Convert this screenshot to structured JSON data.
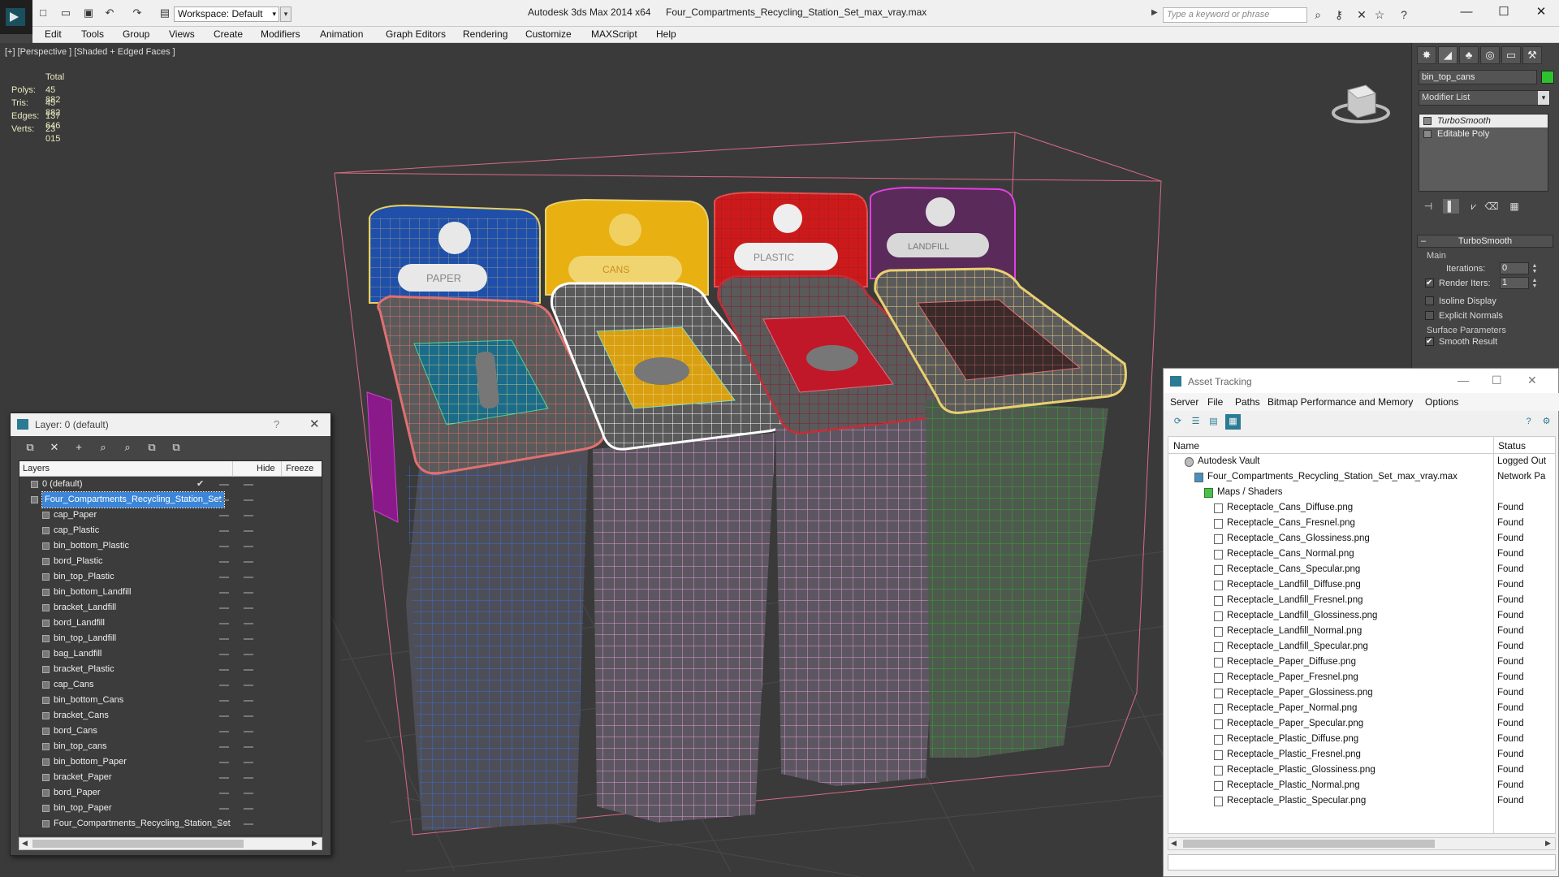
{
  "titlebar": {
    "workspace": "Workspace: Default",
    "app_title": "Autodesk 3ds Max  2014 x64",
    "file_title": "Four_Compartments_Recycling_Station_Set_max_vray.max",
    "search_placeholder": "Type a keyword or phrase",
    "minimize": "—",
    "maximize": "☐",
    "close": "✕"
  },
  "menubar": [
    "Edit",
    "Tools",
    "Group",
    "Views",
    "Create",
    "Modifiers",
    "Animation",
    "Graph Editors",
    "Rendering",
    "Customize",
    "MAXScript",
    "Help"
  ],
  "viewport": {
    "label": "[+] [Perspective ] [Shaded + Edged Faces ]",
    "stats": {
      "header": "Total",
      "rows": [
        {
          "label": "Polys:",
          "value": "45 882"
        },
        {
          "label": "Tris:",
          "value": "45 882"
        },
        {
          "label": "Edges:",
          "value": "137 646"
        },
        {
          "label": "Verts:",
          "value": "23 015"
        }
      ]
    },
    "bin_labels": [
      "PAPER",
      "CANS",
      "PLASTIC",
      "LANDFILL"
    ]
  },
  "command_panel": {
    "object_name": "bin_top_cans",
    "object_color": "#2ec12e",
    "modifier_list": "Modifier List",
    "stack": [
      "TurboSmooth",
      "Editable Poly"
    ],
    "turbosmooth": {
      "title": "TurboSmooth",
      "main": "Main",
      "iterations_label": "Iterations:",
      "iterations_value": "0",
      "render_iters_label": "Render Iters:",
      "render_iters_value": "1",
      "isoline": "Isoline Display",
      "explicit_normals": "Explicit Normals",
      "surface_params": "Surface Parameters",
      "smooth_result": "Smooth Result"
    }
  },
  "layer_window": {
    "title": "Layer: 0 (default)",
    "help": "?",
    "close": "✕",
    "col_layers": "Layers",
    "col_hide": "Hide",
    "col_freeze": "Freeze",
    "layers": [
      {
        "name": "0 (default)",
        "level": 0
      },
      {
        "name": "Four_Compartments_Recycling_Station_Set",
        "level": 0
      },
      {
        "name": "cap_Paper",
        "level": 1
      },
      {
        "name": "cap_Plastic",
        "level": 1
      },
      {
        "name": "bin_bottom_Plastic",
        "level": 1
      },
      {
        "name": "bord_Plastic",
        "level": 1
      },
      {
        "name": "bin_top_Plastic",
        "level": 1
      },
      {
        "name": "bin_bottom_Landfill",
        "level": 1
      },
      {
        "name": "bracket_Landfill",
        "level": 1
      },
      {
        "name": "bord_Landfill",
        "level": 1
      },
      {
        "name": "bin_top_Landfill",
        "level": 1
      },
      {
        "name": "bag_Landfill",
        "level": 1
      },
      {
        "name": "bracket_Plastic",
        "level": 1
      },
      {
        "name": "cap_Cans",
        "level": 1
      },
      {
        "name": "bin_bottom_Cans",
        "level": 1
      },
      {
        "name": "bracket_Cans",
        "level": 1
      },
      {
        "name": "bord_Cans",
        "level": 1
      },
      {
        "name": "bin_top_cans",
        "level": 1
      },
      {
        "name": "bin_bottom_Paper",
        "level": 1
      },
      {
        "name": "bracket_Paper",
        "level": 1
      },
      {
        "name": "bord_Paper",
        "level": 1
      },
      {
        "name": "bin_top_Paper",
        "level": 1
      },
      {
        "name": "Four_Compartments_Recycling_Station_Set",
        "level": 1
      }
    ]
  },
  "asset_window": {
    "title": "Asset Tracking",
    "menu": [
      "Server",
      "File",
      "Paths",
      "Bitmap Performance and Memory",
      "Options"
    ],
    "col_name": "Name",
    "col_status": "Status",
    "rows": [
      {
        "name": "Autodesk Vault",
        "status": "Logged Out",
        "level": 1
      },
      {
        "name": "Four_Compartments_Recycling_Station_Set_max_vray.max",
        "status": "Network Pa",
        "level": 2
      },
      {
        "name": "Maps / Shaders",
        "status": "",
        "level": 3
      },
      {
        "name": "Receptacle_Cans_Diffuse.png",
        "status": "Found",
        "level": 4
      },
      {
        "name": "Receptacle_Cans_Fresnel.png",
        "status": "Found",
        "level": 4
      },
      {
        "name": "Receptacle_Cans_Glossiness.png",
        "status": "Found",
        "level": 4
      },
      {
        "name": "Receptacle_Cans_Normal.png",
        "status": "Found",
        "level": 4
      },
      {
        "name": "Receptacle_Cans_Specular.png",
        "status": "Found",
        "level": 4
      },
      {
        "name": "Receptacle_Landfill_Diffuse.png",
        "status": "Found",
        "level": 4
      },
      {
        "name": "Receptacle_Landfill_Fresnel.png",
        "status": "Found",
        "level": 4
      },
      {
        "name": "Receptacle_Landfill_Glossiness.png",
        "status": "Found",
        "level": 4
      },
      {
        "name": "Receptacle_Landfill_Normal.png",
        "status": "Found",
        "level": 4
      },
      {
        "name": "Receptacle_Landfill_Specular.png",
        "status": "Found",
        "level": 4
      },
      {
        "name": "Receptacle_Paper_Diffuse.png",
        "status": "Found",
        "level": 4
      },
      {
        "name": "Receptacle_Paper_Fresnel.png",
        "status": "Found",
        "level": 4
      },
      {
        "name": "Receptacle_Paper_Glossiness.png",
        "status": "Found",
        "level": 4
      },
      {
        "name": "Receptacle_Paper_Normal.png",
        "status": "Found",
        "level": 4
      },
      {
        "name": "Receptacle_Paper_Specular.png",
        "status": "Found",
        "level": 4
      },
      {
        "name": "Receptacle_Plastic_Diffuse.png",
        "status": "Found",
        "level": 4
      },
      {
        "name": "Receptacle_Plastic_Fresnel.png",
        "status": "Found",
        "level": 4
      },
      {
        "name": "Receptacle_Plastic_Glossiness.png",
        "status": "Found",
        "level": 4
      },
      {
        "name": "Receptacle_Plastic_Normal.png",
        "status": "Found",
        "level": 4
      },
      {
        "name": "Receptacle_Plastic_Specular.png",
        "status": "Found",
        "level": 4
      }
    ]
  },
  "colors": {
    "paper": "#1f4fa8",
    "cans": "#e8b010",
    "plastic": "#cc1a1a",
    "landfill": "#8a1a8a",
    "selection": "#3b86d8"
  }
}
